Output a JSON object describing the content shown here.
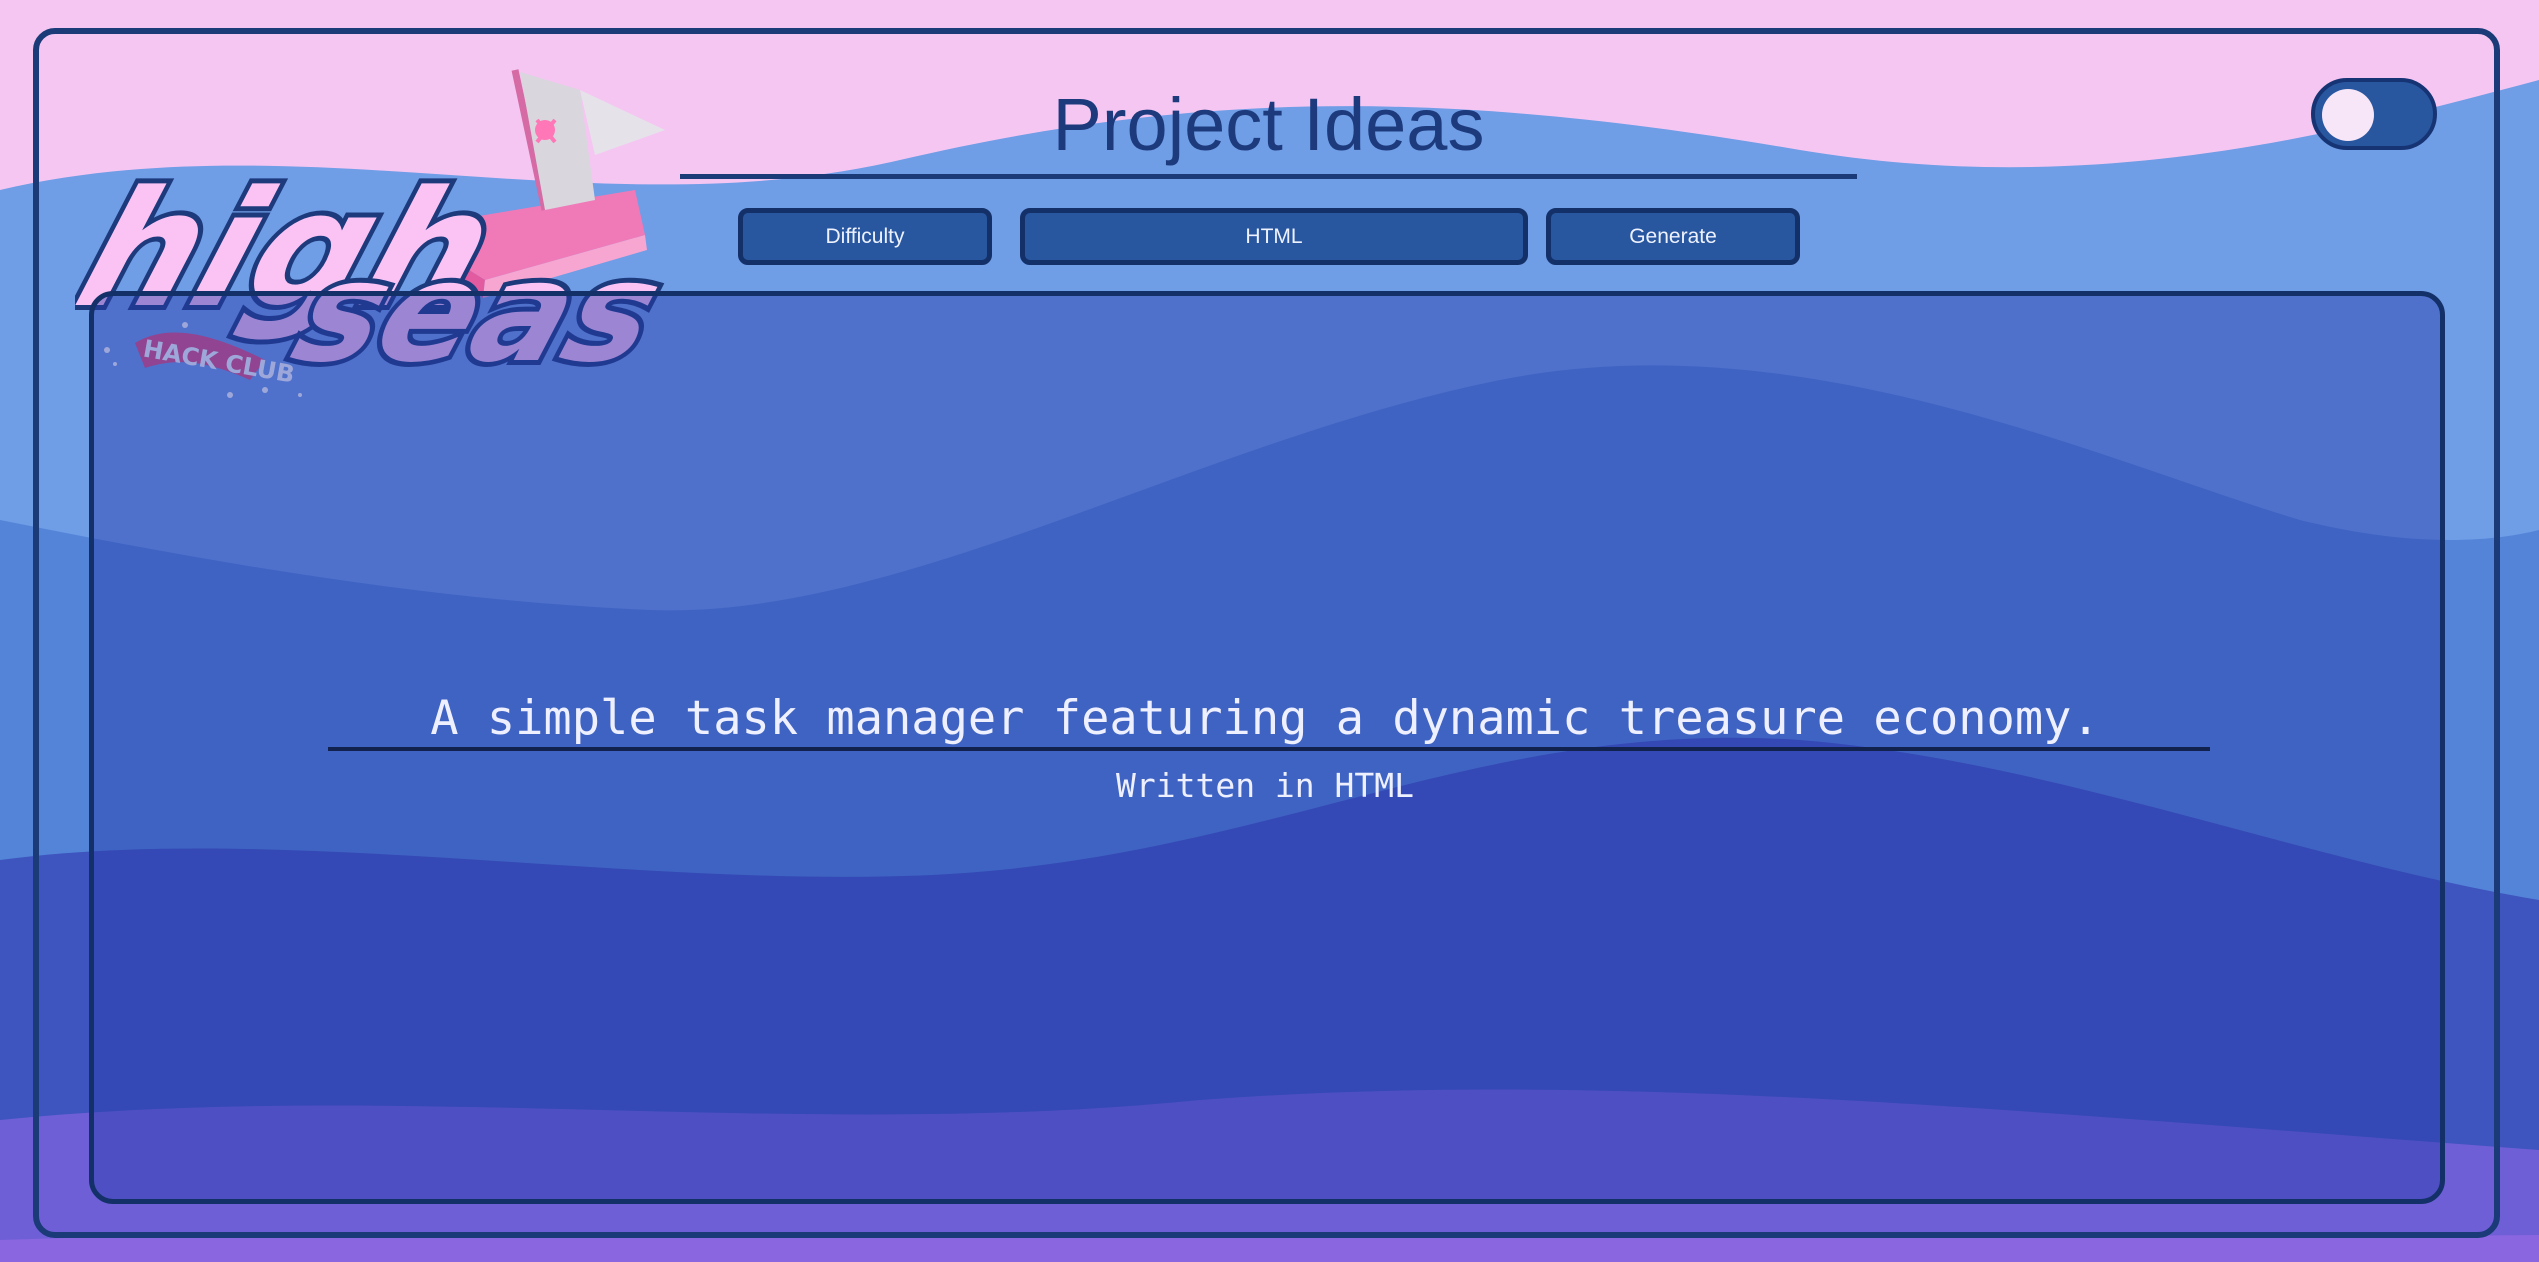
{
  "header": {
    "title": "Project Ideas",
    "logo_text": "High Seas Hack Club"
  },
  "controls": {
    "difficulty_label": "Difficulty",
    "language_label": "HTML",
    "generate_label": "Generate",
    "theme_toggle_on": false
  },
  "result": {
    "idea": "A simple task manager featuring a dynamic treasure economy.",
    "language_line": "Written in HTML"
  },
  "colors": {
    "frame_border": "#1b3a78",
    "button_bg": "#2857a0",
    "text_light": "#eef0ff",
    "title_color": "#1c3a7c"
  }
}
